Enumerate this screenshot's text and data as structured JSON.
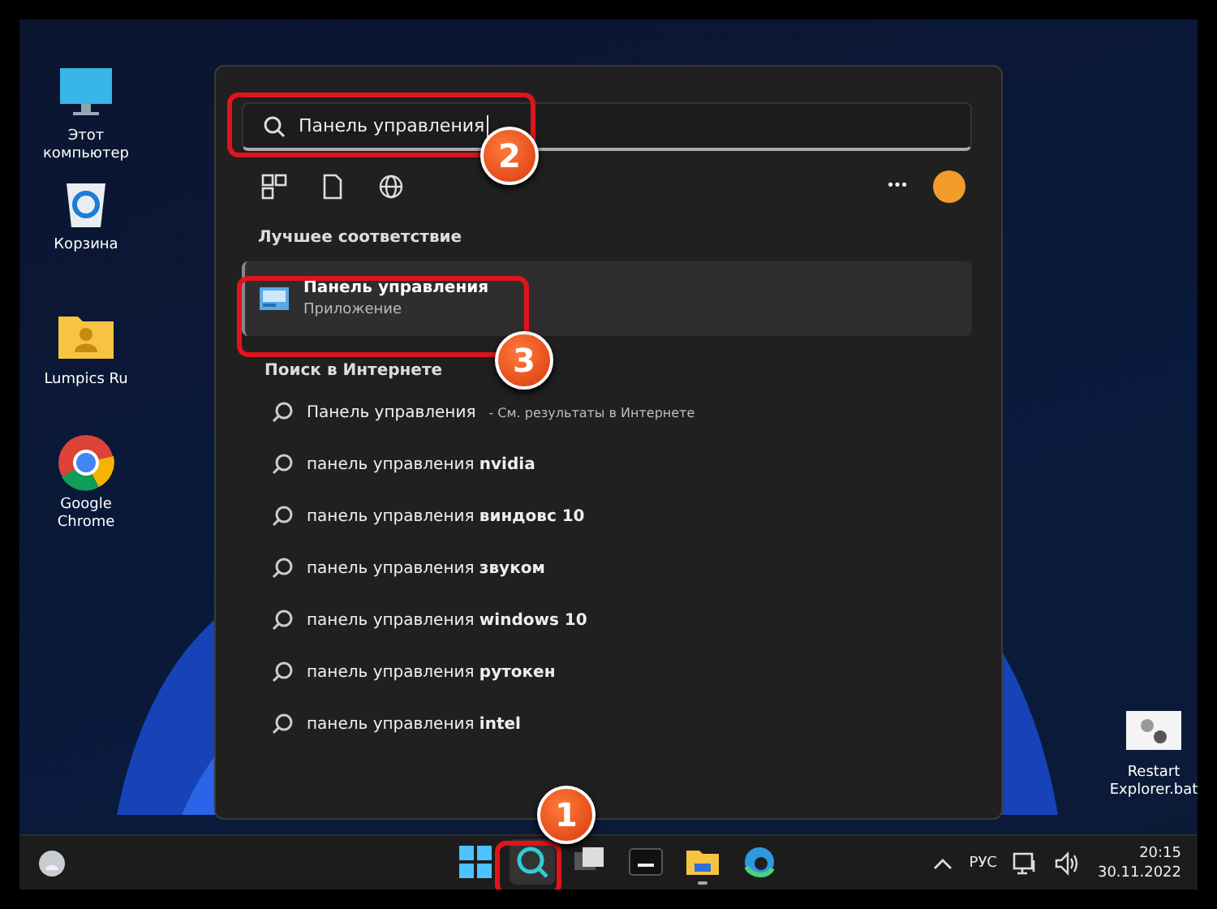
{
  "desktop_icons": [
    {
      "kind": "computer",
      "label": "Этот компьютер"
    },
    {
      "kind": "recycle",
      "label": "Корзина"
    },
    {
      "kind": "folder",
      "label": "Lumpics Ru"
    },
    {
      "kind": "chrome",
      "label": "Google Chrome"
    },
    {
      "kind": "bat",
      "label": "Restart Explorer.bat"
    }
  ],
  "search_panel": {
    "query": "Панель управления",
    "best_match_heading": "Лучшее соответствие",
    "best_match": {
      "title": "Панель управления",
      "subtitle": "Приложение",
      "selected": true
    },
    "web_heading": "Поиск в Интернете",
    "web_results": [
      {
        "query": "Панель управления",
        "suffix": "- См. результаты в Интернете"
      },
      {
        "query": "панель управления **nvidia**"
      },
      {
        "query": "панель управления **виндовс 10**"
      },
      {
        "query": "панель управления **звуком**"
      },
      {
        "query": "панель управления **windows 10**"
      },
      {
        "query": "панель управления **рутокен**"
      },
      {
        "query": "панель управления **intel**"
      }
    ],
    "more": "•••"
  },
  "taskbar": {
    "apps": [
      {
        "kind": "start",
        "selected": false,
        "running": false
      },
      {
        "kind": "search",
        "selected": true,
        "running": false
      },
      {
        "kind": "taskview",
        "selected": false,
        "running": false
      },
      {
        "kind": "terminal",
        "selected": false,
        "running": false
      },
      {
        "kind": "explorer",
        "selected": false,
        "running": true
      },
      {
        "kind": "edge",
        "selected": false,
        "running": false
      }
    ],
    "language": "РУС",
    "time": "20:15",
    "date": "30.11.2022"
  },
  "annotations": [
    {
      "number": "2"
    },
    {
      "number": "3"
    },
    {
      "number": "1"
    }
  ]
}
